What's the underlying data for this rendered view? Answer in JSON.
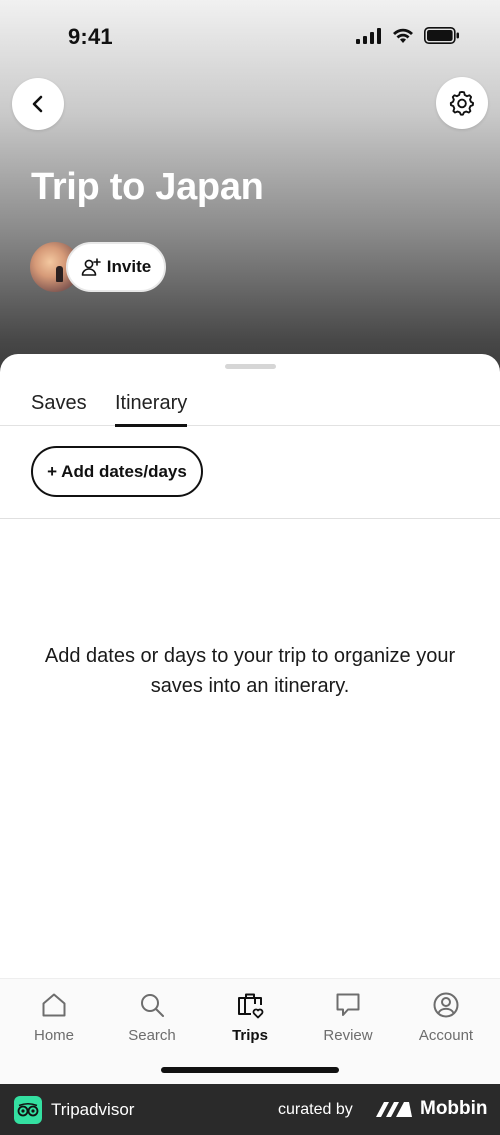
{
  "status_bar": {
    "time": "9:41"
  },
  "header": {
    "trip_title": "Trip to Japan",
    "invite_label": "Invite",
    "back_icon": "chevron-left-icon",
    "settings_icon": "gear-icon"
  },
  "tabs": [
    {
      "label": "Saves",
      "active": false
    },
    {
      "label": "Itinerary",
      "active": true
    }
  ],
  "itinerary": {
    "add_dates_label": "+ Add dates/days",
    "empty_message": "Add dates or days to your trip to organize your saves into an itinerary."
  },
  "bottom_nav": [
    {
      "label": "Home",
      "icon": "home-icon",
      "active": false
    },
    {
      "label": "Search",
      "icon": "search-icon",
      "active": false
    },
    {
      "label": "Trips",
      "icon": "suitcase-heart-icon",
      "active": true
    },
    {
      "label": "Review",
      "icon": "speech-bubble-icon",
      "active": false
    },
    {
      "label": "Account",
      "icon": "user-icon",
      "active": false
    }
  ],
  "footer": {
    "brand": "Tripadvisor",
    "curated_by": "curated by",
    "curator": "Mobbin"
  },
  "colors": {
    "accent": "#111111",
    "tripadvisor_green": "#34e0a1",
    "footer_bg": "#2a2a2a"
  }
}
